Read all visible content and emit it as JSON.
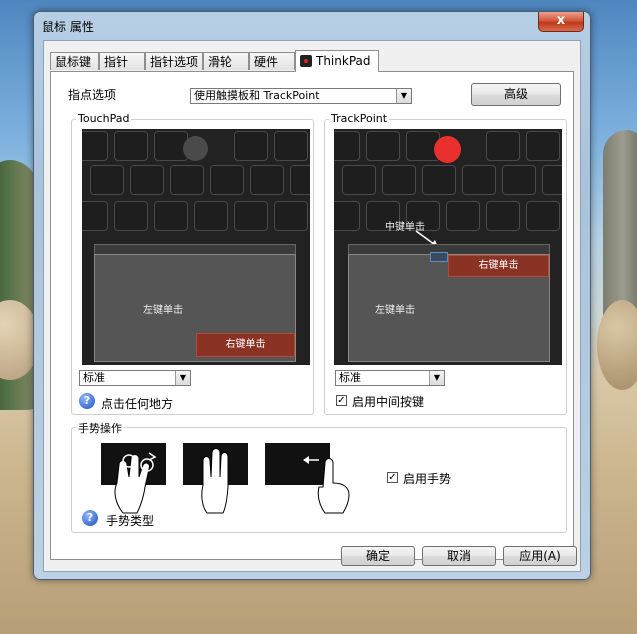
{
  "window": {
    "title": "鼠标 属性",
    "close_label": "x"
  },
  "tabs": [
    "鼠标键",
    "指针",
    "指针选项",
    "滑轮",
    "硬件",
    "ThinkPad"
  ],
  "active_tab": "ThinkPad",
  "pointing": {
    "label": "指点选项",
    "value": "使用触摸板和 TrackPoint",
    "advanced_label": "高级"
  },
  "touchpad": {
    "title": "TouchPad",
    "left_click": "左键单击",
    "right_click": "右键单击",
    "mode_value": "标准",
    "help_label": "点击任何地方"
  },
  "trackpoint": {
    "title": "TrackPoint",
    "middle_click": "中键单击",
    "left_click": "左键单击",
    "right_click": "右键单击",
    "mode_value": "标准",
    "middle_button_label": "启用中间按键",
    "middle_button_checked": true
  },
  "gestures": {
    "title": "手势操作",
    "enable_label": "启用手势",
    "enable_checked": true,
    "help_label": "手势类型"
  },
  "buttons": {
    "ok": "确定",
    "cancel": "取消",
    "apply": "应用(A)"
  },
  "colors": {
    "trackpoint_red": "#e8302c",
    "pad_red": "#8a3324",
    "touch_dot": "#4a4a4a"
  },
  "icons": {
    "help": "help-icon",
    "checkbox": "checkbox-icon",
    "dropdown": "chevron-down-icon"
  }
}
